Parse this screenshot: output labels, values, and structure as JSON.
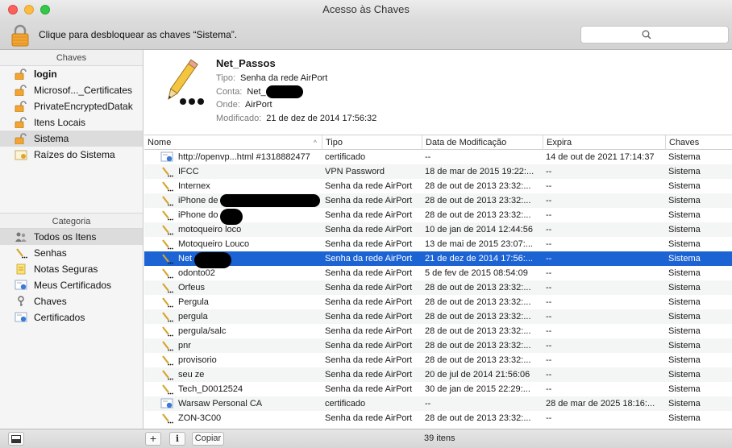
{
  "window": {
    "title": "Acesso às Chaves"
  },
  "toolbar": {
    "unlock_text": "Clique para desbloquear as chaves “Sistema”.",
    "search_placeholder": ""
  },
  "sidebar": {
    "keychains_header": "Chaves",
    "keychains": [
      {
        "label": "login",
        "icon": "lock-icon",
        "bold": true
      },
      {
        "label": "Microsof..._Certificates",
        "icon": "lock-icon"
      },
      {
        "label": "PrivateEncryptedDatak",
        "icon": "lock-icon"
      },
      {
        "label": "Itens Locais",
        "icon": "lock-icon"
      },
      {
        "label": "Sistema",
        "icon": "lock-icon",
        "selected": true
      },
      {
        "label": "Raízes do Sistema",
        "icon": "certificate-folder-icon"
      }
    ],
    "category_header": "Categoria",
    "categories": [
      {
        "label": "Todos os Itens",
        "icon": "people-icon",
        "selected": true
      },
      {
        "label": "Senhas",
        "icon": "pencil-icon"
      },
      {
        "label": "Notas Seguras",
        "icon": "note-icon"
      },
      {
        "label": "Meus Certificados",
        "icon": "certificate-icon"
      },
      {
        "label": "Chaves",
        "icon": "key-icon"
      },
      {
        "label": "Certificados",
        "icon": "certificate-icon"
      }
    ]
  },
  "detail": {
    "name": "Net_Passos",
    "tipo_label": "Tipo:",
    "tipo": "Senha da rede AirPort",
    "conta_label": "Conta:",
    "conta": "Net_",
    "onde_label": "Onde:",
    "onde": "AirPort",
    "modificado_label": "Modificado:",
    "modificado": "21 de dez de 2014 17:56:32"
  },
  "table": {
    "columns": [
      "Nome",
      "Tipo",
      "Data de Modificação",
      "Expira",
      "Chaves"
    ],
    "sort_indicator": "^",
    "rows": [
      {
        "name": "http://openvp...html #1318882477",
        "tipo": "certificado",
        "mod": "--",
        "exp": "14 de out de 2021 17:14:37",
        "chaves": "Sistema",
        "icon": "certificate-icon"
      },
      {
        "name": "IFCC",
        "tipo": "VPN Password",
        "mod": "18 de mar de 2015 19:22:...",
        "exp": "--",
        "chaves": "Sistema",
        "icon": "pencil-icon"
      },
      {
        "name": "Internex",
        "tipo": "Senha da rede AirPort",
        "mod": "28 de out de 2013 23:32:...",
        "exp": "--",
        "chaves": "Sistema",
        "icon": "pencil-icon"
      },
      {
        "name": "iPhone de",
        "tipo": "Senha da rede AirPort",
        "mod": "28 de out de 2013 23:32:...",
        "exp": "--",
        "chaves": "Sistema",
        "icon": "pencil-icon"
      },
      {
        "name": "iPhone do",
        "tipo": "Senha da rede AirPort",
        "mod": "28 de out de 2013 23:32:...",
        "exp": "--",
        "chaves": "Sistema",
        "icon": "pencil-icon"
      },
      {
        "name": "motoqueiro loco",
        "tipo": "Senha da rede AirPort",
        "mod": "10 de jan de 2014 12:44:56",
        "exp": "--",
        "chaves": "Sistema",
        "icon": "pencil-icon"
      },
      {
        "name": "Motoqueiro Louco",
        "tipo": "Senha da rede AirPort",
        "mod": "13 de mai de 2015 23:07:...",
        "exp": "--",
        "chaves": "Sistema",
        "icon": "pencil-icon"
      },
      {
        "name": "Net",
        "tipo": "Senha da rede AirPort",
        "mod": "21 de dez de 2014 17:56:...",
        "exp": "--",
        "chaves": "Sistema",
        "icon": "pencil-icon",
        "selected": true
      },
      {
        "name": "odonto02",
        "tipo": "Senha da rede AirPort",
        "mod": "5 de fev de 2015 08:54:09",
        "exp": "--",
        "chaves": "Sistema",
        "icon": "pencil-icon"
      },
      {
        "name": "Orfeus",
        "tipo": "Senha da rede AirPort",
        "mod": "28 de out de 2013 23:32:...",
        "exp": "--",
        "chaves": "Sistema",
        "icon": "pencil-icon"
      },
      {
        "name": "Pergula",
        "tipo": "Senha da rede AirPort",
        "mod": "28 de out de 2013 23:32:...",
        "exp": "--",
        "chaves": "Sistema",
        "icon": "pencil-icon"
      },
      {
        "name": "pergula",
        "tipo": "Senha da rede AirPort",
        "mod": "28 de out de 2013 23:32:...",
        "exp": "--",
        "chaves": "Sistema",
        "icon": "pencil-icon"
      },
      {
        "name": "pergula/salc",
        "tipo": "Senha da rede AirPort",
        "mod": "28 de out de 2013 23:32:...",
        "exp": "--",
        "chaves": "Sistema",
        "icon": "pencil-icon"
      },
      {
        "name": "pnr",
        "tipo": "Senha da rede AirPort",
        "mod": "28 de out de 2013 23:32:...",
        "exp": "--",
        "chaves": "Sistema",
        "icon": "pencil-icon"
      },
      {
        "name": "provisorio",
        "tipo": "Senha da rede AirPort",
        "mod": "28 de out de 2013 23:32:...",
        "exp": "--",
        "chaves": "Sistema",
        "icon": "pencil-icon"
      },
      {
        "name": "seu ze",
        "tipo": "Senha da rede AirPort",
        "mod": "20 de jul de 2014 21:56:06",
        "exp": "--",
        "chaves": "Sistema",
        "icon": "pencil-icon"
      },
      {
        "name": "Tech_D0012524",
        "tipo": "Senha da rede AirPort",
        "mod": "30 de jan de 2015 22:29:...",
        "exp": "--",
        "chaves": "Sistema",
        "icon": "pencil-icon"
      },
      {
        "name": "Warsaw Personal CA",
        "tipo": "certificado",
        "mod": "--",
        "exp": "28 de mar de 2025 18:16:...",
        "chaves": "Sistema",
        "icon": "certificate-icon"
      },
      {
        "name": "ZON-3C00",
        "tipo": "Senha da rede AirPort",
        "mod": "28 de out de 2013 23:32:...",
        "exp": "--",
        "chaves": "Sistema",
        "icon": "pencil-icon"
      }
    ]
  },
  "status": {
    "copy_label": "Copiar",
    "count": "39 itens"
  },
  "colors": {
    "selection": "#1c63d4",
    "sidebar_selection": "#dcdcdc"
  }
}
